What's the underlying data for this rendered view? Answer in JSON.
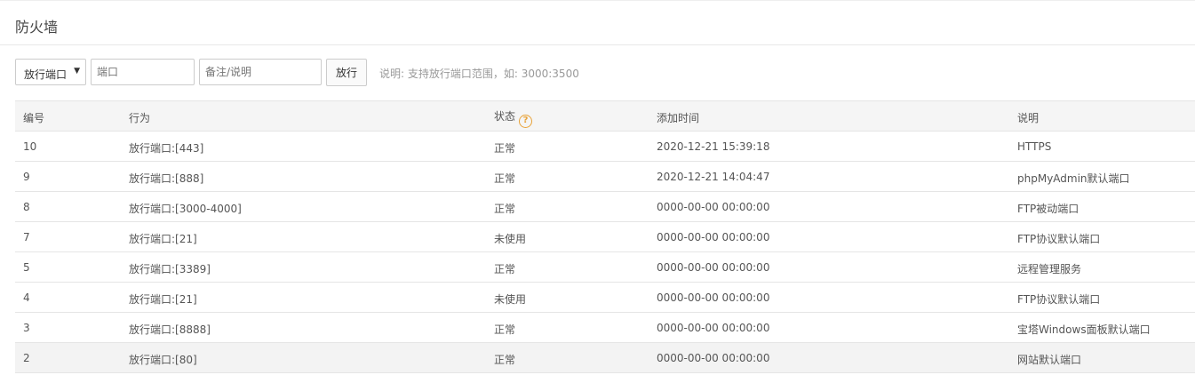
{
  "panel": {
    "title": "防火墙"
  },
  "toolbar": {
    "select_value": "放行端口",
    "port_placeholder": "端口",
    "note_placeholder": "备注/说明",
    "submit_label": "放行",
    "hint": "说明: 支持放行端口范围，如: 3000:3500"
  },
  "table": {
    "headers": [
      "编号",
      "行为",
      "状态",
      "添加时间",
      "说明"
    ],
    "rows": [
      {
        "id": "10",
        "action": "放行端口:[443]",
        "status": "正常",
        "time": "2020-12-21 15:39:18",
        "note": "HTTPS"
      },
      {
        "id": "9",
        "action": "放行端口:[888]",
        "status": "正常",
        "time": "2020-12-21 14:04:47",
        "note": "phpMyAdmin默认端口"
      },
      {
        "id": "8",
        "action": "放行端口:[3000-4000]",
        "status": "正常",
        "time": "0000-00-00 00:00:00",
        "note": "FTP被动端口"
      },
      {
        "id": "7",
        "action": "放行端口:[21]",
        "status": "未使用",
        "time": "0000-00-00 00:00:00",
        "note": "FTP协议默认端口"
      },
      {
        "id": "5",
        "action": "放行端口:[3389]",
        "status": "正常",
        "time": "0000-00-00 00:00:00",
        "note": "远程管理服务"
      },
      {
        "id": "4",
        "action": "放行端口:[21]",
        "status": "未使用",
        "time": "0000-00-00 00:00:00",
        "note": "FTP协议默认端口"
      },
      {
        "id": "3",
        "action": "放行端口:[8888]",
        "status": "正常",
        "time": "0000-00-00 00:00:00",
        "note": "宝塔Windows面板默认端口"
      },
      {
        "id": "2",
        "action": "放行端口:[80]",
        "status": "正常",
        "time": "0000-00-00 00:00:00",
        "note": "网站默认端口"
      }
    ]
  },
  "icons": {
    "status_help": "question-circle-icon",
    "select_caret": "caret-down-icon"
  },
  "colors": {
    "help_icon": "#e8a33a",
    "header_bg": "#f5f5f5"
  }
}
